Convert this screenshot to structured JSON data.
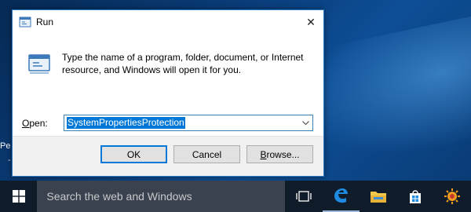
{
  "desktop": {
    "partial_label": "Pe",
    "partial_dash": "-"
  },
  "dialog": {
    "title": "Run",
    "close_glyph": "✕",
    "description": "Type the name of a program, folder, document, or Internet resource, and Windows will open it for you.",
    "open_label_accel": "O",
    "open_label_rest": "pen:",
    "input_value": "SystemPropertiesProtection",
    "buttons": {
      "ok": "OK",
      "cancel": "Cancel",
      "browse_accel": "B",
      "browse_rest": "rowse..."
    }
  },
  "taskbar": {
    "search_placeholder": "Search the web and Windows",
    "icons": [
      "windows-start-icon",
      "task-view-icon",
      "edge-icon",
      "file-explorer-icon",
      "store-icon",
      "photos-icon"
    ]
  },
  "colors": {
    "accent": "#0078d7",
    "taskbar": "#101c2a",
    "search_box": "#3a4250"
  }
}
